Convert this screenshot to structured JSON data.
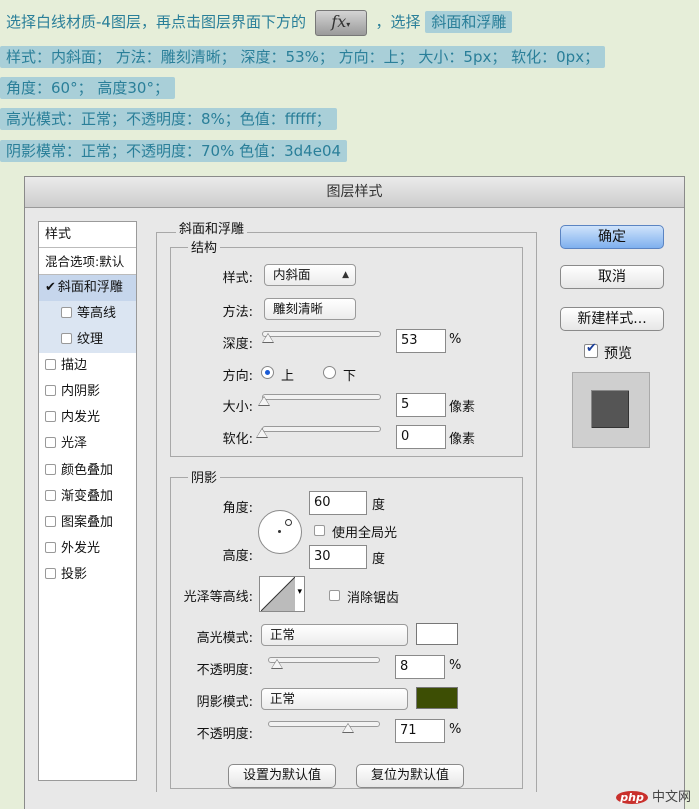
{
  "instructions": {
    "line1_prefix": "选择白线材质-4图层，再点击图层界面下方的",
    "fx_label": "fx",
    "line1_mid": "，选择",
    "line1_highlight": "斜面和浮雕",
    "line2": "样式：内斜面；  方法：雕刻清晰；  深度：53%；  方向：上；  大小：5px；  软化：0px；",
    "line3": "角度：60°；  高度30°；",
    "line4": "高光模式：正常；不透明度：8%；色值：ffffff；",
    "line5": "阴影模常：正常；不透明度：70%   色值：3d4e04"
  },
  "dialog": {
    "title": "图层样式",
    "left_header": "样式",
    "left_items": [
      {
        "label": "混合选项:默认",
        "type": "plain"
      },
      {
        "label": "斜面和浮雕",
        "type": "checked"
      },
      {
        "label": "等高线",
        "type": "sub"
      },
      {
        "label": "纹理",
        "type": "sub"
      },
      {
        "label": "描边",
        "type": "cb"
      },
      {
        "label": "内阴影",
        "type": "cb"
      },
      {
        "label": "内发光",
        "type": "cb"
      },
      {
        "label": "光泽",
        "type": "cb"
      },
      {
        "label": "颜色叠加",
        "type": "cb"
      },
      {
        "label": "渐变叠加",
        "type": "cb"
      },
      {
        "label": "图案叠加",
        "type": "cb"
      },
      {
        "label": "外发光",
        "type": "cb"
      },
      {
        "label": "投影",
        "type": "cb"
      }
    ],
    "bevel_title": "斜面和浮雕",
    "structure_title": "结构",
    "style_label": "样式:",
    "style_value": "内斜面",
    "technique_label": "方法:",
    "technique_value": "雕刻清晰",
    "depth_label": "深度:",
    "depth_value": "53",
    "depth_unit": "%",
    "depth_slider": 0.05,
    "direction_label": "方向:",
    "direction_up": "上",
    "direction_down": "下",
    "size_label": "大小:",
    "size_value": "5",
    "size_unit": "像素",
    "size_slider": 0.02,
    "soften_label": "软化:",
    "soften_value": "0",
    "soften_unit": "像素",
    "soften_slider": 0.0,
    "shading_title": "阴影",
    "angle_label": "角度:",
    "angle_value": "60",
    "angle_unit": "度",
    "global_light_label": "使用全局光",
    "altitude_label": "高度:",
    "altitude_value": "30",
    "altitude_unit": "度",
    "gloss_contour_label": "光泽等高线:",
    "antialias_label": "消除锯齿",
    "highlight_mode_label": "高光模式:",
    "highlight_mode_value": "正常",
    "highlight_color": "#ffffff",
    "highlight_opacity_label": "不透明度:",
    "highlight_opacity_value": "8",
    "highlight_opacity_unit": "%",
    "highlight_opacity_slider": 0.08,
    "shadow_mode_label": "阴影模式:",
    "shadow_mode_value": "正常",
    "shadow_color": "#3d4e04",
    "shadow_opacity_label": "不透明度:",
    "shadow_opacity_value": "71",
    "shadow_opacity_unit": "%",
    "shadow_opacity_slider": 0.71,
    "make_default_label": "设置为默认值",
    "reset_default_label": "复位为默认值",
    "ok_label": "确定",
    "cancel_label": "取消",
    "new_style_label": "新建样式...",
    "preview_label": "预览"
  },
  "watermark": {
    "logo": "php",
    "text": "中文网"
  }
}
